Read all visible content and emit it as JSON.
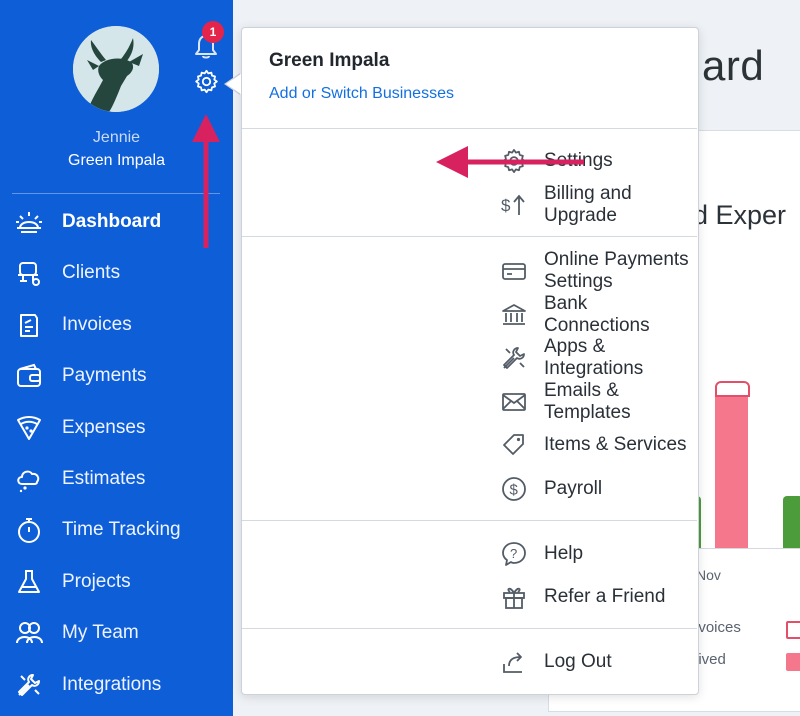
{
  "user": {
    "first_name": "Jennie",
    "business": "Green Impala"
  },
  "notifications": {
    "count": "1"
  },
  "sidebar": {
    "items": [
      {
        "label": "Dashboard",
        "icon": "sun-icon",
        "active": true
      },
      {
        "label": "Clients",
        "icon": "clients-icon"
      },
      {
        "label": "Invoices",
        "icon": "invoice-icon"
      },
      {
        "label": "Payments",
        "icon": "wallet-icon"
      },
      {
        "label": "Expenses",
        "icon": "pizza-icon"
      },
      {
        "label": "Estimates",
        "icon": "cloud-icon"
      },
      {
        "label": "Time Tracking",
        "icon": "stopwatch-icon"
      },
      {
        "label": "Projects",
        "icon": "flask-icon"
      },
      {
        "label": "My Team",
        "icon": "team-icon"
      },
      {
        "label": "Integrations",
        "icon": "tools-icon"
      }
    ]
  },
  "main": {
    "title_fragment": "ard",
    "card_title_fragment": "d Exper",
    "x_label": "Nov",
    "legend": [
      "nvoices",
      "eived"
    ]
  },
  "dropdown": {
    "business_name": "Green Impala",
    "switch_link": "Add or Switch Businesses",
    "groups": [
      [
        {
          "label": "Settings",
          "icon": "gear-icon"
        },
        {
          "label": "Billing and Upgrade",
          "icon": "dollar-up-icon"
        }
      ],
      [
        {
          "label": "Online Payments Settings",
          "icon": "credit-card-icon"
        },
        {
          "label": "Bank Connections",
          "icon": "bank-icon"
        },
        {
          "label": "Apps & Integrations",
          "icon": "tools-icon"
        },
        {
          "label": "Emails & Templates",
          "icon": "envelope-icon"
        },
        {
          "label": "Items & Services",
          "icon": "tag-icon"
        },
        {
          "label": "Payroll",
          "icon": "dollar-circle-icon"
        }
      ],
      [
        {
          "label": "Help",
          "icon": "help-icon"
        },
        {
          "label": "Refer a Friend",
          "icon": "gift-icon"
        }
      ],
      [
        {
          "label": "Log Out",
          "icon": "logout-icon"
        }
      ]
    ]
  },
  "colors": {
    "sidebar_bg": "#0e5ed8",
    "accent_link": "#1470e0",
    "annotation_arrow": "#d8225f",
    "bar_pink": "#f4778b",
    "bar_green": "#4d9c3b"
  }
}
